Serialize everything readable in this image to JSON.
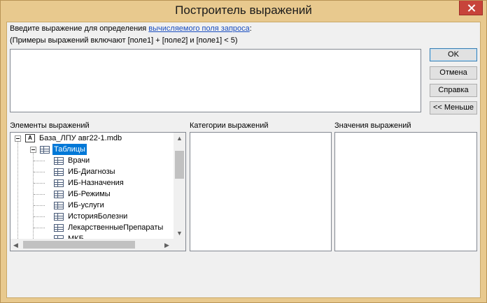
{
  "window": {
    "title": "Построитель выражений"
  },
  "instructions": {
    "line1_prefix": "Введите выражение для определения ",
    "line1_link": "вычисляемого поля запроса",
    "line1_suffix": ":",
    "line2": "(Примеры выражений включают [поле1] + [поле2] и [поле1] < 5)"
  },
  "expression_box": {
    "value": ""
  },
  "buttons": {
    "ok": "OK",
    "cancel": "Отмена",
    "help": "Справка",
    "less": "<< Меньше"
  },
  "panels": {
    "elements_label": "Элементы выражений",
    "categories_label": "Категории выражений",
    "values_label": "Значения выражений"
  },
  "tree": {
    "root": "База_ЛПУ авг22-1.mdb",
    "root_icon": "database-icon",
    "group": "Таблицы",
    "items": [
      "Врачи",
      "ИБ-Диагнозы",
      "ИБ-Назначения",
      "ИБ-Режимы",
      "ИБ-услуги",
      "ИсторияБолезни",
      "ЛекарственныеПрепараты",
      "МКБ"
    ]
  },
  "colors": {
    "title_bar": "#e8c98e",
    "close_button": "#c7443a",
    "selection": "#0078d7",
    "link": "#1a4ec0"
  }
}
